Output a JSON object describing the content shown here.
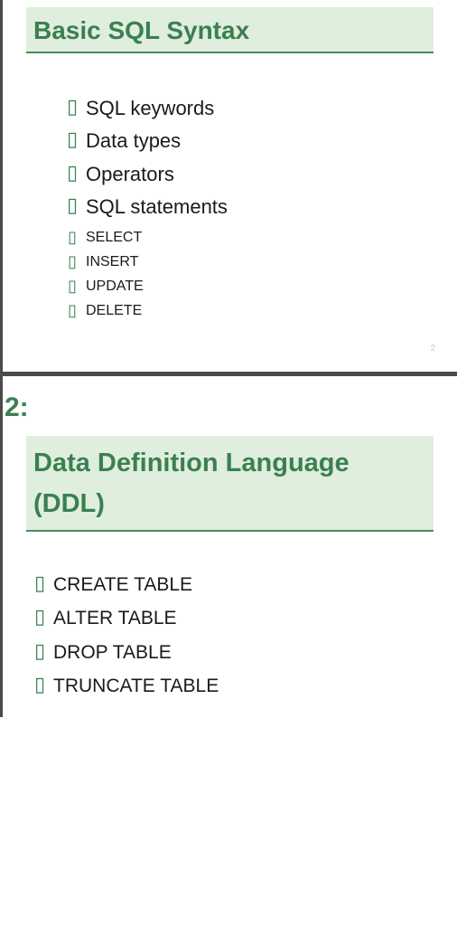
{
  "slide1": {
    "title": "Basic SQL Syntax",
    "items": [
      {
        "label": "SQL keywords",
        "sub": false
      },
      {
        "label": "Data types",
        "sub": false
      },
      {
        "label": "Operators",
        "sub": false
      },
      {
        "label": "SQL statements",
        "sub": false
      },
      {
        "label": "SELECT",
        "sub": true
      },
      {
        "label": "INSERT",
        "sub": true
      },
      {
        "label": "UPDATE",
        "sub": true
      },
      {
        "label": "DELETE",
        "sub": true
      }
    ],
    "page_number": "2"
  },
  "slide2": {
    "prefix": "2:",
    "title": "Data Definition Language (DDL)",
    "items": [
      {
        "label": "CREATE TABLE"
      },
      {
        "label": "ALTER TABLE"
      },
      {
        "label": "DROP TABLE"
      },
      {
        "label": "TRUNCATE TABLE"
      }
    ]
  },
  "bullet_glyph": "▯"
}
